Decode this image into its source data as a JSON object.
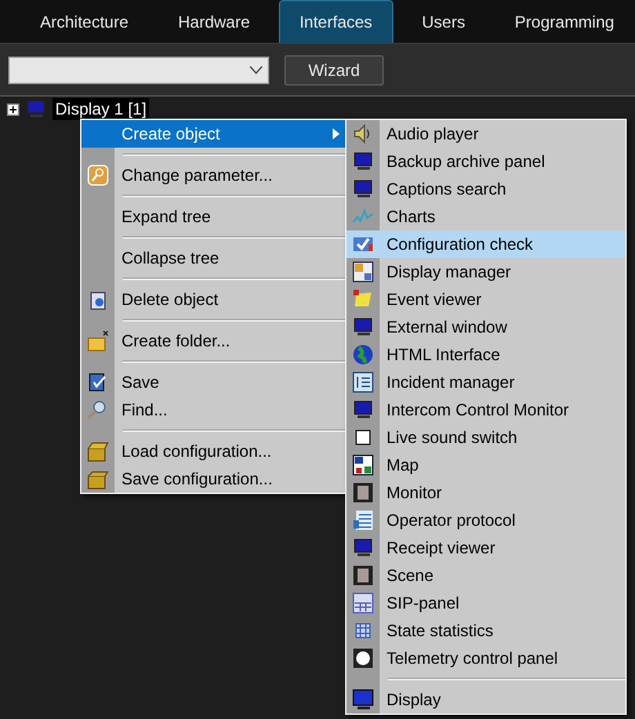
{
  "tabs": [
    {
      "label": "Architecture",
      "selected": false
    },
    {
      "label": "Hardware",
      "selected": false
    },
    {
      "label": "Interfaces",
      "selected": true
    },
    {
      "label": "Users",
      "selected": false
    },
    {
      "label": "Programming",
      "selected": false
    }
  ],
  "toolbar": {
    "wizard_button": "Wizard"
  },
  "tree": [
    {
      "label": "Display 1 [1]",
      "selected": true
    }
  ],
  "context_menu": {
    "items": [
      {
        "kind": "item",
        "label": "Create object",
        "has_submenu": true,
        "selected": true
      },
      {
        "kind": "separator"
      },
      {
        "kind": "item",
        "label": "Change parameter...",
        "has_submenu": false,
        "selected": false
      },
      {
        "kind": "separator"
      },
      {
        "kind": "item",
        "label": "Expand tree",
        "has_submenu": false,
        "selected": false
      },
      {
        "kind": "separator"
      },
      {
        "kind": "item",
        "label": "Collapse tree",
        "has_submenu": false,
        "selected": false
      },
      {
        "kind": "separator"
      },
      {
        "kind": "item",
        "label": "Delete object",
        "has_submenu": false,
        "selected": false
      },
      {
        "kind": "separator"
      },
      {
        "kind": "item",
        "label": "Create folder...",
        "has_submenu": false,
        "selected": false
      },
      {
        "kind": "separator"
      },
      {
        "kind": "item",
        "label": "Save",
        "has_submenu": false,
        "selected": false
      },
      {
        "kind": "item",
        "label": "Find...",
        "has_submenu": false,
        "selected": false
      },
      {
        "kind": "separator"
      },
      {
        "kind": "item",
        "label": "Load configuration...",
        "has_submenu": false,
        "selected": false
      },
      {
        "kind": "item",
        "label": "Save configuration...",
        "has_submenu": false,
        "selected": false
      }
    ]
  },
  "submenu": {
    "items": [
      {
        "kind": "item",
        "label": "Audio player",
        "selected": false
      },
      {
        "kind": "item",
        "label": "Backup archive panel",
        "selected": false
      },
      {
        "kind": "item",
        "label": "Captions search",
        "selected": false
      },
      {
        "kind": "item",
        "label": "Charts",
        "selected": false
      },
      {
        "kind": "item",
        "label": "Configuration check",
        "selected": true
      },
      {
        "kind": "item",
        "label": "Display manager",
        "selected": false
      },
      {
        "kind": "item",
        "label": "Event viewer",
        "selected": false
      },
      {
        "kind": "item",
        "label": "External window",
        "selected": false
      },
      {
        "kind": "item",
        "label": "HTML Interface",
        "selected": false
      },
      {
        "kind": "item",
        "label": "Incident manager",
        "selected": false
      },
      {
        "kind": "item",
        "label": "Intercom Control Monitor",
        "selected": false
      },
      {
        "kind": "item",
        "label": "Live sound switch",
        "selected": false
      },
      {
        "kind": "item",
        "label": "Map",
        "selected": false
      },
      {
        "kind": "item",
        "label": "Monitor",
        "selected": false
      },
      {
        "kind": "item",
        "label": "Operator protocol",
        "selected": false
      },
      {
        "kind": "item",
        "label": "Receipt viewer",
        "selected": false
      },
      {
        "kind": "item",
        "label": "Scene",
        "selected": false
      },
      {
        "kind": "item",
        "label": "SIP-panel",
        "selected": false
      },
      {
        "kind": "item",
        "label": "State statistics",
        "selected": false
      },
      {
        "kind": "item",
        "label": "Telemetry control panel",
        "selected": false
      },
      {
        "kind": "separator"
      },
      {
        "kind": "item",
        "label": "Display",
        "selected": false
      }
    ]
  }
}
